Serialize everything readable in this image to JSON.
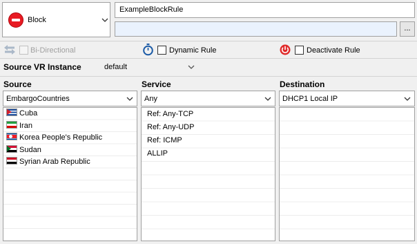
{
  "action": {
    "label": "Block",
    "icon": "block-icon",
    "color": "#e81b23"
  },
  "rule_name": "ExampleBlockRule",
  "description": "",
  "more_button": "...",
  "options": {
    "bidirectional": {
      "label": "Bi-Directional",
      "checked": false,
      "enabled": false
    },
    "dynamic_rule": {
      "label": "Dynamic Rule",
      "checked": false
    },
    "deactivate_rule": {
      "label": "Deactivate Rule",
      "checked": false
    }
  },
  "vr_instance": {
    "label": "Source VR Instance",
    "value": "default"
  },
  "source": {
    "header": "Source",
    "selected": "EmbargoCountries",
    "items": [
      {
        "label": "Cuba",
        "flag": "cuba-flag"
      },
      {
        "label": "Iran",
        "flag": "iran-flag"
      },
      {
        "label": "Korea People's Republic",
        "flag": "north-korea-flag"
      },
      {
        "label": "Sudan",
        "flag": "sudan-flag"
      },
      {
        "label": "Syrian Arab Republic",
        "flag": "syria-flag"
      }
    ]
  },
  "service": {
    "header": "Service",
    "selected": "Any",
    "items": [
      "Ref: Any-TCP",
      "Ref: Any-UDP",
      "Ref: ICMP",
      "ALLIP"
    ]
  },
  "destination": {
    "header": "Destination",
    "selected": "DHCP1 Local IP",
    "items": []
  }
}
